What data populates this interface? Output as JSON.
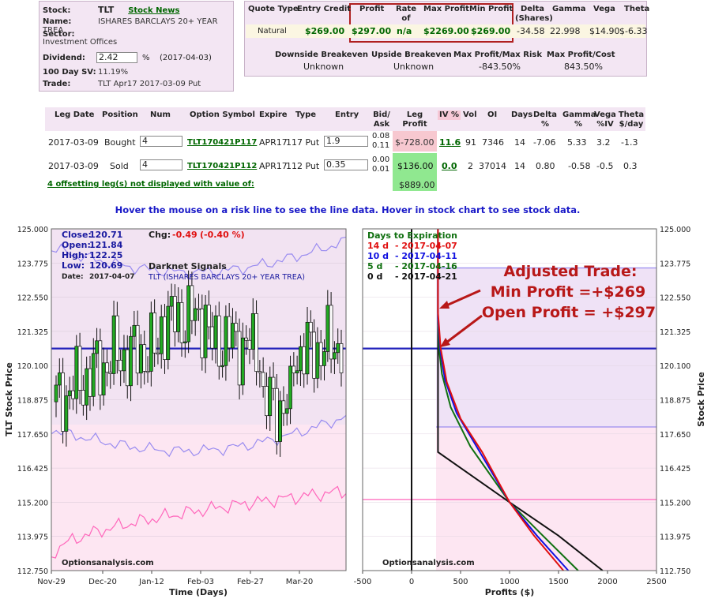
{
  "stock_info": {
    "stock_label": "Stock:",
    "symbol": "TLT",
    "news_link": "Stock News",
    "name_label": "Name:",
    "name": "ISHARES BARCLAYS 20+ YEAR TREA",
    "sector_label": "Sector:",
    "sector": "Investment Offices",
    "dividend_label": "Dividend:",
    "dividend": "2.42",
    "dividend_unit": "%",
    "dividend_date": "(2017-04-03)",
    "sv_label": "100 Day SV:",
    "sv": "11.19%",
    "trade_label": "Trade:",
    "trade": "TLT Apr17 2017-03-09 Put"
  },
  "quote": {
    "headers": [
      "Quote Type",
      "Entry Credit",
      "Profit",
      "Rate of Return",
      "Max Profit",
      "Min Profit",
      "Delta (Shares)",
      "Gamma",
      "Vega",
      "Theta"
    ],
    "values": [
      "Natural",
      "$269.00",
      "$297.00",
      "n/a",
      "$2269.00",
      "$269.00",
      "-34.58",
      "22.998",
      "$14.90",
      "$-6.33"
    ],
    "headers2": [
      "Downside Breakeven",
      "Upside Breakeven",
      "Max Profit/Max Risk",
      "Max Profit/Cost"
    ],
    "values2": [
      "Unknown",
      "Unknown",
      "-843.50%",
      "843.50%"
    ]
  },
  "legs": {
    "headers": [
      "Leg Date",
      "Position",
      "Num",
      "Option Symbol",
      "Expire",
      "Type",
      "Entry",
      "Bid/ Ask",
      "Leg Profit",
      "IV %",
      "Vol",
      "OI",
      "Days",
      "Delta %",
      "Gamma %",
      "Vega %IV",
      "Theta $/day"
    ],
    "rows": [
      {
        "date": "2017-03-09",
        "position": "Bought",
        "num": "4",
        "symbol": "TLT170421P117",
        "expire": "APR17",
        "type": "117 Put",
        "entry": "1.9",
        "bid": "0.08",
        "ask": "0.11",
        "profit": "$-728.00",
        "iv": "11.6",
        "vol": "91",
        "oi": "7346",
        "days": "14",
        "delta": "-7.06",
        "gamma": "5.33",
        "vega": "3.2",
        "theta": "-1.3"
      },
      {
        "date": "2017-03-09",
        "position": "Sold",
        "num": "4",
        "symbol": "TLT170421P112",
        "expire": "APR17",
        "type": "112 Put",
        "entry": "0.35",
        "bid": "0.00",
        "ask": "0.01",
        "profit": "$136.00",
        "iv": "0.0",
        "vol": "2",
        "oi": "37014",
        "days": "14",
        "delta": "0.80",
        "gamma": "-0.58",
        "vega": "-0.5",
        "theta": "0.3"
      }
    ],
    "offsetting_note": "4 offsetting leg(s) not displayed with value of:",
    "offsetting_value": "$889.00"
  },
  "hover_message": "Hover the mouse on a risk line to see the line data. Hover in stock chart to see stock data.",
  "stock_chart": {
    "close_label": "Close:",
    "close": "120.71",
    "open_label": "Open:",
    "open": "121.84",
    "high_label": "High:",
    "high": "122.25",
    "low_label": "Low:",
    "low": "120.69",
    "date_label": "Date:",
    "date": "2017-04-07",
    "chg_label": "Chg:",
    "chg": "-0.49",
    "chg_pct": "(-0.40 %)",
    "signals_title": "Darknet Signals",
    "signals_sub": "TLT (ISHARES BARCLAYS 20+ YEAR TREA)",
    "watermark": "Optionsanalysis.com",
    "ylabel": "TLT Stock Price",
    "xlabel": "Time (Days)",
    "x_ticks": [
      "Nov-29",
      "Dec-20",
      "Jan-12",
      "Feb-03",
      "Feb-27",
      "Mar-20"
    ],
    "y_ticks": [
      "125.000",
      "123.775",
      "122.550",
      "121.325",
      "120.100",
      "118.875",
      "117.650",
      "116.425",
      "115.200",
      "113.975",
      "112.750"
    ]
  },
  "risk_chart": {
    "legend_title": "Days to Expiration",
    "legend": [
      {
        "days": "14 d",
        "date": "- 2017-04-07",
        "color": "#e01010"
      },
      {
        "days": "10 d",
        "date": "- 2017-04-11",
        "color": "#1010e0"
      },
      {
        "days": "5 d",
        "date": "- 2017-04-16",
        "color": "#107010"
      },
      {
        "days": "0 d",
        "date": "- 2017-04-21",
        "color": "#111111"
      }
    ],
    "annotation": [
      "Adjusted Trade:",
      "Min Profit =+$269",
      "Open Profit = +$297"
    ],
    "watermark": "Optionsanalysis.com",
    "xlabel": "Profits ($)",
    "ylabel": "Stock Price",
    "x_ticks": [
      "-500",
      "0",
      "500",
      "1000",
      "1500",
      "2000",
      "2500"
    ],
    "y_ticks": [
      "125.000",
      "123.775",
      "122.550",
      "121.325",
      "120.100",
      "118.875",
      "117.650",
      "116.425",
      "115.200",
      "113.975",
      "112.750"
    ]
  },
  "chart_data": [
    {
      "type": "line",
      "title": "Darknet Signals",
      "xlabel": "Time (Days)",
      "ylabel": "TLT Stock Price",
      "ylim": [
        112.75,
        125.0
      ],
      "x": [
        "Nov-29",
        "Dec-20",
        "Jan-12",
        "Feb-03",
        "Feb-27",
        "Mar-20"
      ],
      "series": [
        {
          "values": [
            118.8,
            120.4,
            120.7,
            121.0,
            120.4,
            120.9
          ]
        }
      ],
      "current_price": 120.71
    },
    {
      "type": "line",
      "xlabel": "Profits ($)",
      "ylabel": "Stock Price",
      "xlim": [
        -500,
        2500
      ],
      "ylim": [
        112.75,
        125.0
      ],
      "series": [
        {
          "name": "14 d - 2017-04-07",
          "color": "#e01010",
          "points": [
            [
              269,
              125.0
            ],
            [
              269,
              122.0
            ],
            [
              297,
              120.71
            ],
            [
              360,
              119.5
            ],
            [
              500,
              118.2
            ],
            [
              720,
              117.0
            ],
            [
              1000,
              115.2
            ],
            [
              1250,
              114.0
            ],
            [
              1550,
              112.75
            ]
          ]
        },
        {
          "name": "10 d - 2017-04-11",
          "color": "#1010e0",
          "points": [
            [
              269,
              125.0
            ],
            [
              269,
              121.8
            ],
            [
              290,
              120.71
            ],
            [
              340,
              119.6
            ],
            [
              460,
              118.4
            ],
            [
              680,
              117.1
            ],
            [
              1000,
              115.2
            ],
            [
              1280,
              114.0
            ],
            [
              1600,
              112.75
            ]
          ]
        },
        {
          "name": "5 d - 2017-04-16",
          "color": "#107010",
          "points": [
            [
              269,
              125.0
            ],
            [
              269,
              121.6
            ],
            [
              280,
              120.71
            ],
            [
              310,
              119.8
            ],
            [
              400,
              118.6
            ],
            [
              600,
              117.2
            ],
            [
              1000,
              115.2
            ],
            [
              1340,
              114.0
            ],
            [
              1700,
              112.75
            ]
          ]
        },
        {
          "name": "0 d - 2017-04-21",
          "color": "#111111",
          "points": [
            [
              269,
              125.0
            ],
            [
              269,
              117.0
            ],
            [
              1000,
              115.2
            ],
            [
              1500,
              114.0
            ],
            [
              1950,
              112.75
            ]
          ]
        }
      ],
      "reference_lines": {
        "current_price": 120.71,
        "upper": 123.6,
        "middle": 117.9,
        "lower": 115.3
      }
    }
  ]
}
